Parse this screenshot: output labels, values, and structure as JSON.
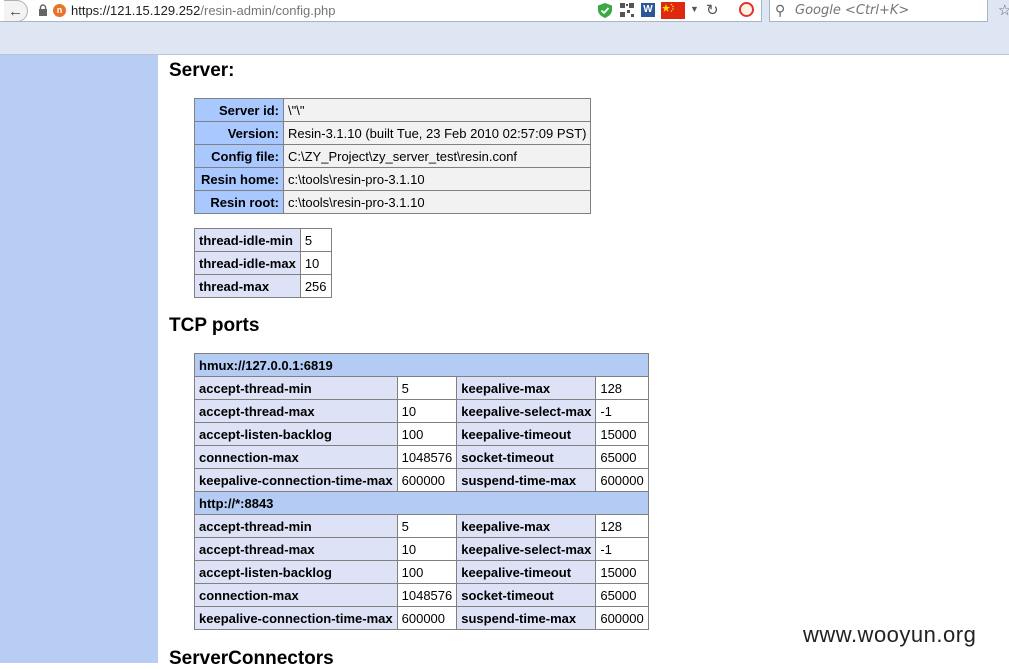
{
  "browser": {
    "url_main": "https://121.15.129.252",
    "url_path": "/resin-admin/config.php",
    "search_placeholder": "Google <Ctrl+K>",
    "word_icon_label": "W",
    "site_icon_label": "n"
  },
  "headings": {
    "server": "Server:",
    "tcp_ports": "TCP ports",
    "server_connectors": "ServerConnectors"
  },
  "server_info": [
    {
      "label": "Server id:",
      "value": "\\\"\\\""
    },
    {
      "label": "Version:",
      "value": "Resin-3.1.10 (built Tue, 23 Feb 2010 02:57:09 PST)"
    },
    {
      "label": "Config file:",
      "value": "C:\\ZY_Project\\zy_server_test\\resin.conf"
    },
    {
      "label": "Resin home:",
      "value": "c:\\tools\\resin-pro-3.1.10"
    },
    {
      "label": "Resin root:",
      "value": "c:\\tools\\resin-pro-3.1.10"
    }
  ],
  "threads": [
    {
      "label": "thread-idle-min",
      "value": "5"
    },
    {
      "label": "thread-idle-max",
      "value": "10"
    },
    {
      "label": "thread-max",
      "value": "256"
    }
  ],
  "ports": [
    {
      "name": "hmux://127.0.0.1:6819",
      "rows": [
        {
          "k1": "accept-thread-min",
          "v1": "5",
          "k2": "keepalive-max",
          "v2": "128"
        },
        {
          "k1": "accept-thread-max",
          "v1": "10",
          "k2": "keepalive-select-max",
          "v2": "-1"
        },
        {
          "k1": "accept-listen-backlog",
          "v1": "100",
          "k2": "keepalive-timeout",
          "v2": "15000"
        },
        {
          "k1": "connection-max",
          "v1": "1048576",
          "k2": "socket-timeout",
          "v2": "65000"
        },
        {
          "k1": "keepalive-connection-time-max",
          "v1": "600000",
          "k2": "suspend-time-max",
          "v2": "600000"
        }
      ]
    },
    {
      "name": "http://*:8843",
      "rows": [
        {
          "k1": "accept-thread-min",
          "v1": "5",
          "k2": "keepalive-max",
          "v2": "128"
        },
        {
          "k1": "accept-thread-max",
          "v1": "10",
          "k2": "keepalive-select-max",
          "v2": "-1"
        },
        {
          "k1": "accept-listen-backlog",
          "v1": "100",
          "k2": "keepalive-timeout",
          "v2": "15000"
        },
        {
          "k1": "connection-max",
          "v1": "1048576",
          "k2": "socket-timeout",
          "v2": "65000"
        },
        {
          "k1": "keepalive-connection-time-max",
          "v1": "600000",
          "k2": "suspend-time-max",
          "v2": "600000"
        }
      ]
    }
  ],
  "watermark": "www.wooyun.org",
  "colors": {
    "sidebar": "#b8cdf3",
    "key_blue": "#a8c8ff",
    "key_lavender": "#dde2f7",
    "port_header": "#b4cbf3"
  }
}
